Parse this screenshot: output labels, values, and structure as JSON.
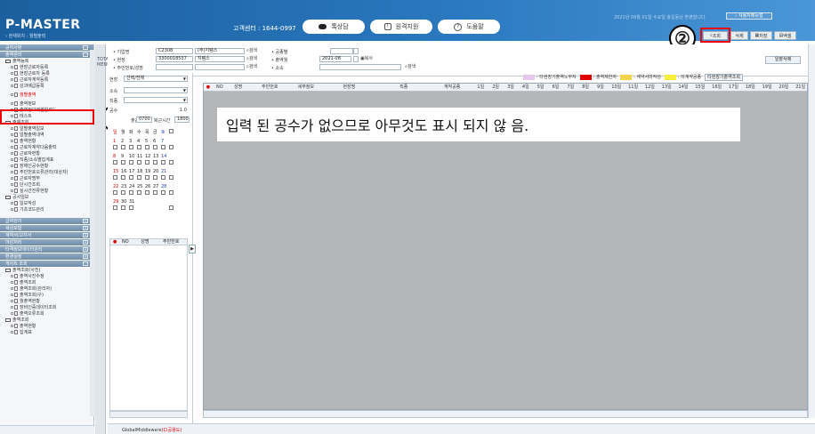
{
  "header": {
    "logo": "P-MASTER",
    "breadcrumb": "› 현재위치 : 월별출력",
    "call_center": "고객센터 : 1644-0997",
    "buttons": [
      "톡상담",
      "원격지원",
      "도움말"
    ],
    "user_info": "2021년 09월 01일 수요일 홍길동님 환영합니다.",
    "manager_btn": "› 사용자메뉴얼"
  },
  "toolbar": {
    "search": "조회",
    "delete": "삭제",
    "save": "저장",
    "excel": "엑셀"
  },
  "callouts": {
    "one": "①",
    "two": "②"
  },
  "sidebar": {
    "sections_top": [
      "공지사항",
      "출역관리"
    ],
    "group1": "출역등록",
    "group1_items": [
      "현장근로자등록",
      "현장근로자 등록",
      "근로자계약등록",
      "성과배급등록",
      "월별출역",
      "출역정보",
      "출역정보엑셀업로드",
      "테스트"
    ],
    "group2": "출역조회",
    "group2_items": [
      "일별출역일보",
      "일별출역내역",
      "출역현황",
      "근로자계약다음출력",
      "근로자현황",
      "직종/소속별집계표",
      "장애인공수현황",
      "주민번호오류관리(대상자)",
      "근로자명부",
      "단시간조회",
      "실시간전류현황"
    ],
    "group3": "공사일보",
    "group3_items": [
      "일보작성",
      "기초코드관리"
    ],
    "sections_mid": [
      "급여관리",
      "세금보험",
      "계약서/고지서",
      "마감처리",
      "타격정보데이터관리",
      "환경설정",
      "게이트 조회"
    ],
    "group4": "출역조회(사진)",
    "group4_items": [
      "출역사진수정",
      "출역조회",
      "출역조회(관리자)",
      "출역조회(구)",
      "월출역현황",
      "장비인증데이터조회",
      "출역오류조회"
    ],
    "group5": "출역조회",
    "group5_items": [
      "출역현황",
      "집계표"
    ]
  },
  "vstrip": "TOTAL MENU",
  "filters": {
    "bizcode_label": "• 기업명",
    "bizcode_code": "C2308",
    "bizcode_name": "(주)지템스",
    "site_label": "• 현장",
    "site_code": "3300018537",
    "site_name": "지템스",
    "resno_label": "• 주민번호/성명",
    "search": "검색",
    "work_label": "• 공종별",
    "month_label": "• 출역월",
    "month_value": "2021-08",
    "copy": "복사",
    "team_label": "• 소속",
    "all_not": "일괄삭제"
  },
  "midpanel": {
    "site_label": "현장",
    "site_select": "선택/전체",
    "team_label": "소속",
    "job_label": "직종",
    "gongsu_label": "공수",
    "gongsu_value": "1.0",
    "start_label": "출근시간",
    "start_value": "0700",
    "end_label": "퇴근시간",
    "end_value": "1800",
    "weekdays": [
      "일",
      "월",
      "화",
      "수",
      "목",
      "금",
      "토"
    ],
    "weeks": [
      [
        "1",
        "2",
        "3",
        "4",
        "5",
        "6",
        "7"
      ],
      [
        "8",
        "9",
        "10",
        "11",
        "12",
        "13",
        "14"
      ],
      [
        "15",
        "16",
        "17",
        "18",
        "19",
        "20",
        "21"
      ],
      [
        "22",
        "23",
        "24",
        "25",
        "26",
        "27",
        "28"
      ],
      [
        "29",
        "30",
        "31"
      ]
    ],
    "sub_headers": [
      "NO",
      "성명",
      "주민번호"
    ]
  },
  "legend": {
    "items": [
      {
        "label": ": 타현장기출역노무자",
        "color": "#e6c8ef"
      },
      {
        "label": ": 출역제한자",
        "color": "#e00000"
      },
      {
        "label": ": 계약서미작성",
        "color": "#f4d24a"
      },
      {
        "label": ": 미계약공종",
        "color": "#f6f03a"
      }
    ],
    "button": "타현장기출역조회"
  },
  "grid": {
    "headers": [
      "NO",
      "성명",
      "주민번호",
      "세부정보",
      "현장명",
      "직종",
      "계약공종",
      "1일",
      "2일",
      "3일",
      "4일",
      "5일",
      "6일",
      "7일",
      "8일",
      "9일",
      "10일",
      "11일",
      "12일",
      "13일",
      "14일",
      "15일",
      "16일",
      "17일",
      "18일",
      "19일",
      "20일",
      "21일"
    ]
  },
  "message": "입력 된 공수가 없으므로 아무것도 표시 되지 않 음.",
  "footer": {
    "text": "GlobalMiddleware",
    "red": "(Ci공용도)"
  }
}
